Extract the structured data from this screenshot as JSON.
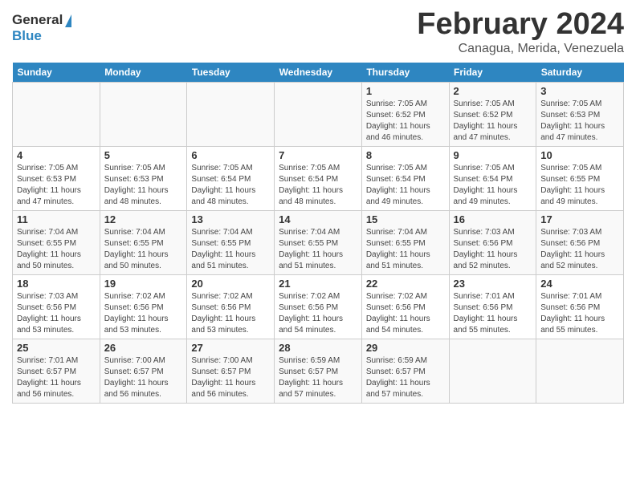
{
  "header": {
    "logo_line1": "General",
    "logo_line2": "Blue",
    "month_year": "February 2024",
    "location": "Canagua, Merida, Venezuela"
  },
  "weekdays": [
    "Sunday",
    "Monday",
    "Tuesday",
    "Wednesday",
    "Thursday",
    "Friday",
    "Saturday"
  ],
  "weeks": [
    [
      {
        "day": "",
        "info": ""
      },
      {
        "day": "",
        "info": ""
      },
      {
        "day": "",
        "info": ""
      },
      {
        "day": "",
        "info": ""
      },
      {
        "day": "1",
        "info": "Sunrise: 7:05 AM\nSunset: 6:52 PM\nDaylight: 11 hours\nand 46 minutes."
      },
      {
        "day": "2",
        "info": "Sunrise: 7:05 AM\nSunset: 6:52 PM\nDaylight: 11 hours\nand 47 minutes."
      },
      {
        "day": "3",
        "info": "Sunrise: 7:05 AM\nSunset: 6:53 PM\nDaylight: 11 hours\nand 47 minutes."
      }
    ],
    [
      {
        "day": "4",
        "info": "Sunrise: 7:05 AM\nSunset: 6:53 PM\nDaylight: 11 hours\nand 47 minutes."
      },
      {
        "day": "5",
        "info": "Sunrise: 7:05 AM\nSunset: 6:53 PM\nDaylight: 11 hours\nand 48 minutes."
      },
      {
        "day": "6",
        "info": "Sunrise: 7:05 AM\nSunset: 6:54 PM\nDaylight: 11 hours\nand 48 minutes."
      },
      {
        "day": "7",
        "info": "Sunrise: 7:05 AM\nSunset: 6:54 PM\nDaylight: 11 hours\nand 48 minutes."
      },
      {
        "day": "8",
        "info": "Sunrise: 7:05 AM\nSunset: 6:54 PM\nDaylight: 11 hours\nand 49 minutes."
      },
      {
        "day": "9",
        "info": "Sunrise: 7:05 AM\nSunset: 6:54 PM\nDaylight: 11 hours\nand 49 minutes."
      },
      {
        "day": "10",
        "info": "Sunrise: 7:05 AM\nSunset: 6:55 PM\nDaylight: 11 hours\nand 49 minutes."
      }
    ],
    [
      {
        "day": "11",
        "info": "Sunrise: 7:04 AM\nSunset: 6:55 PM\nDaylight: 11 hours\nand 50 minutes."
      },
      {
        "day": "12",
        "info": "Sunrise: 7:04 AM\nSunset: 6:55 PM\nDaylight: 11 hours\nand 50 minutes."
      },
      {
        "day": "13",
        "info": "Sunrise: 7:04 AM\nSunset: 6:55 PM\nDaylight: 11 hours\nand 51 minutes."
      },
      {
        "day": "14",
        "info": "Sunrise: 7:04 AM\nSunset: 6:55 PM\nDaylight: 11 hours\nand 51 minutes."
      },
      {
        "day": "15",
        "info": "Sunrise: 7:04 AM\nSunset: 6:55 PM\nDaylight: 11 hours\nand 51 minutes."
      },
      {
        "day": "16",
        "info": "Sunrise: 7:03 AM\nSunset: 6:56 PM\nDaylight: 11 hours\nand 52 minutes."
      },
      {
        "day": "17",
        "info": "Sunrise: 7:03 AM\nSunset: 6:56 PM\nDaylight: 11 hours\nand 52 minutes."
      }
    ],
    [
      {
        "day": "18",
        "info": "Sunrise: 7:03 AM\nSunset: 6:56 PM\nDaylight: 11 hours\nand 53 minutes."
      },
      {
        "day": "19",
        "info": "Sunrise: 7:02 AM\nSunset: 6:56 PM\nDaylight: 11 hours\nand 53 minutes."
      },
      {
        "day": "20",
        "info": "Sunrise: 7:02 AM\nSunset: 6:56 PM\nDaylight: 11 hours\nand 53 minutes."
      },
      {
        "day": "21",
        "info": "Sunrise: 7:02 AM\nSunset: 6:56 PM\nDaylight: 11 hours\nand 54 minutes."
      },
      {
        "day": "22",
        "info": "Sunrise: 7:02 AM\nSunset: 6:56 PM\nDaylight: 11 hours\nand 54 minutes."
      },
      {
        "day": "23",
        "info": "Sunrise: 7:01 AM\nSunset: 6:56 PM\nDaylight: 11 hours\nand 55 minutes."
      },
      {
        "day": "24",
        "info": "Sunrise: 7:01 AM\nSunset: 6:56 PM\nDaylight: 11 hours\nand 55 minutes."
      }
    ],
    [
      {
        "day": "25",
        "info": "Sunrise: 7:01 AM\nSunset: 6:57 PM\nDaylight: 11 hours\nand 56 minutes."
      },
      {
        "day": "26",
        "info": "Sunrise: 7:00 AM\nSunset: 6:57 PM\nDaylight: 11 hours\nand 56 minutes."
      },
      {
        "day": "27",
        "info": "Sunrise: 7:00 AM\nSunset: 6:57 PM\nDaylight: 11 hours\nand 56 minutes."
      },
      {
        "day": "28",
        "info": "Sunrise: 6:59 AM\nSunset: 6:57 PM\nDaylight: 11 hours\nand 57 minutes."
      },
      {
        "day": "29",
        "info": "Sunrise: 6:59 AM\nSunset: 6:57 PM\nDaylight: 11 hours\nand 57 minutes."
      },
      {
        "day": "",
        "info": ""
      },
      {
        "day": "",
        "info": ""
      }
    ]
  ]
}
